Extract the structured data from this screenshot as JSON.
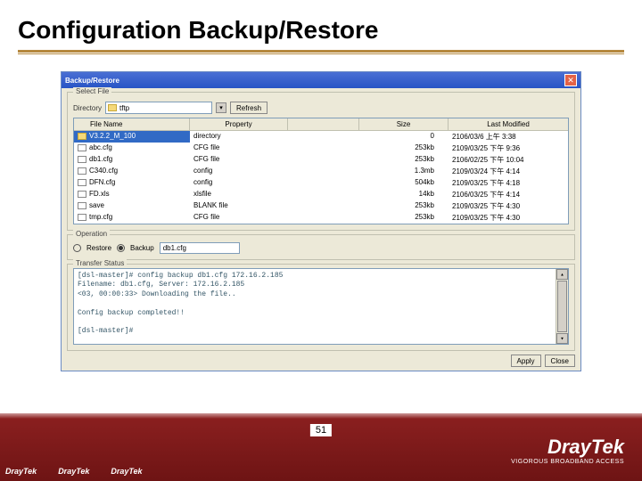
{
  "slide": {
    "title": "Configuration Backup/Restore",
    "page_number": "51"
  },
  "window": {
    "title": "Backup/Restore",
    "select_file": {
      "group_label": "Select File",
      "directory_label": "Directory",
      "directory_value": "tftp",
      "refresh_label": "Refresh",
      "headers": {
        "name": "File Name",
        "prop": "Property",
        "size": "Size",
        "mod": "Last Modified"
      },
      "rows": [
        {
          "name": "V3.2.2_M_100",
          "prop": "directory",
          "size": "0",
          "mod": "2106/03/6 上午 3:38",
          "folder": true,
          "selected": true
        },
        {
          "name": "abc.cfg",
          "prop": "CFG file",
          "size": "253kb",
          "mod": "2109/03/25 下午 9:36",
          "folder": false
        },
        {
          "name": "db1.cfg",
          "prop": "CFG file",
          "size": "253kb",
          "mod": "2106/02/25 下午 10:04",
          "folder": false
        },
        {
          "name": "C340.cfg",
          "prop": "config",
          "size": "1.3mb",
          "mod": "2109/03/24 下午 4:14",
          "folder": false
        },
        {
          "name": "DFN.cfg",
          "prop": "config",
          "size": "504kb",
          "mod": "2109/03/25 下午 4:18",
          "folder": false
        },
        {
          "name": "FD.xls",
          "prop": "xlsfile",
          "size": "14kb",
          "mod": "2106/03/25 下午 4:14",
          "folder": false
        },
        {
          "name": "save",
          "prop": "BLANK file",
          "size": "253kb",
          "mod": "2109/03/25 下午 4:30",
          "folder": false
        },
        {
          "name": "tmp.cfg",
          "prop": "CFG file",
          "size": "253kb",
          "mod": "2109/03/25 下午 4:30",
          "folder": false
        }
      ]
    },
    "operation": {
      "group_label": "Operation",
      "restore_label": "Restore",
      "backup_label": "Backup",
      "backup_selected": true,
      "filename_value": "db1.cfg"
    },
    "transfer": {
      "group_label": "Transfer Status",
      "log": "[dsl-master]# config backup db1.cfg 172.16.2.185\nFilename: db1.cfg,  Server: 172.16.2.185\n<03, 00:00:33> Downloading the file..\n\nConfig backup completed!!\n\n[dsl-master]#"
    },
    "buttons": {
      "apply": "Apply",
      "close": "Close"
    }
  },
  "brand": {
    "small": "DrayTek",
    "big": "DrayTek",
    "tagline": "VIGOROUS BROADBAND ACCESS"
  }
}
